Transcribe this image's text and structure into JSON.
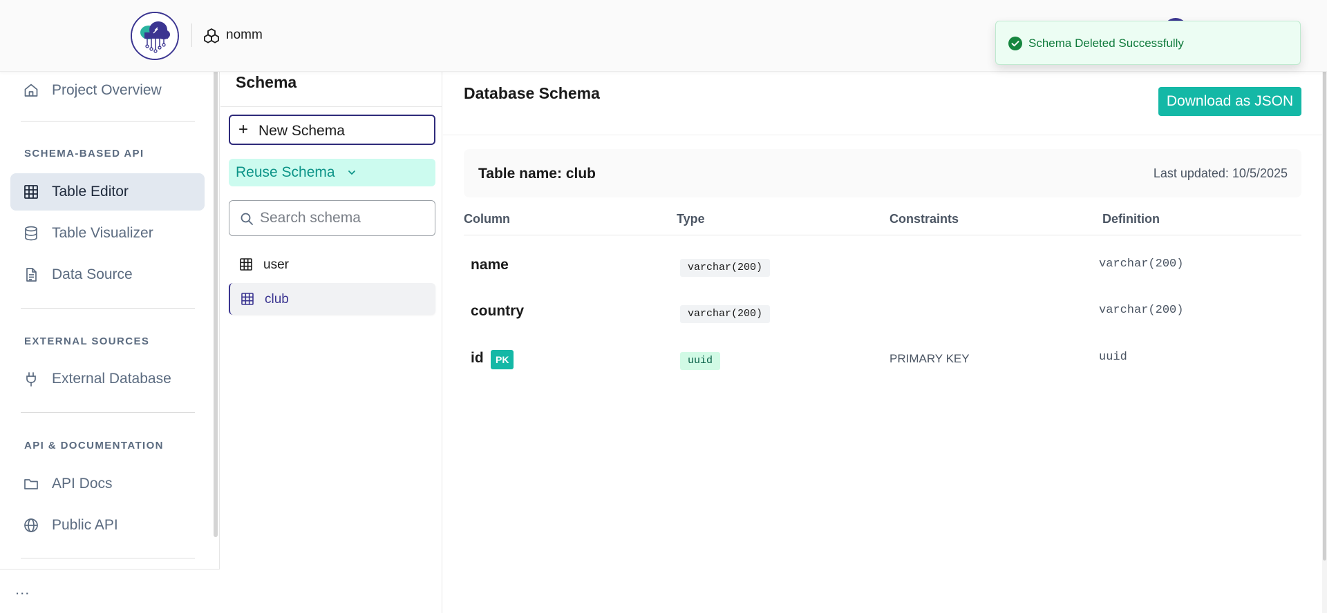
{
  "header": {
    "project_name": "nomm",
    "logo_icon": "cloud-circuit-logo",
    "project_icon": "cubes-icon"
  },
  "toast": {
    "message": "Schema Deleted Successfully",
    "icon": "check-circle-icon",
    "color": "#0f7a3b"
  },
  "sidebar": {
    "overview": {
      "label": "Project Overview",
      "icon": "home-icon"
    },
    "sections": [
      {
        "title": "SCHEMA-BASED API",
        "items": [
          {
            "label": "Table Editor",
            "icon": "table-grid-icon",
            "active": true
          },
          {
            "label": "Table Visualizer",
            "icon": "database-icon",
            "active": false
          },
          {
            "label": "Data Source",
            "icon": "document-icon",
            "active": false
          }
        ]
      },
      {
        "title": "EXTERNAL SOURCES",
        "items": [
          {
            "label": "External Database",
            "icon": "plug-icon",
            "active": false
          }
        ]
      },
      {
        "title": "API & DOCUMENTATION",
        "items": [
          {
            "label": "API Docs",
            "icon": "folder-icon",
            "active": false
          },
          {
            "label": "Public API",
            "icon": "globe-icon",
            "active": false
          }
        ]
      }
    ],
    "more_label": "..."
  },
  "schema_panel": {
    "title": "Schema",
    "new_button": "New Schema",
    "reuse_button": "Reuse Schema",
    "search_placeholder": "Search schema",
    "items": [
      {
        "label": "user",
        "active": false
      },
      {
        "label": "club",
        "active": true
      }
    ]
  },
  "main": {
    "title": "Database Schema",
    "download_button": "Download as JSON",
    "table_name": "Table name: club",
    "last_updated": "Last updated: 10/5/2025",
    "columns": [
      "Column",
      "Type",
      "Constraints",
      "Definition"
    ],
    "rows": [
      {
        "name": "name",
        "pk": "",
        "type": "varchar(200)",
        "constraints": "",
        "definition": "varchar(200)"
      },
      {
        "name": "country",
        "pk": "",
        "type": "varchar(200)",
        "constraints": "",
        "definition": "varchar(200)"
      },
      {
        "name": "id",
        "pk": "PK",
        "type": "uuid",
        "constraints": "PRIMARY KEY",
        "definition": "uuid"
      }
    ]
  },
  "colors": {
    "accent_teal": "#14b8a6",
    "brand_indigo": "#3b3591",
    "active_nav_bg": "#e2e8f0"
  }
}
